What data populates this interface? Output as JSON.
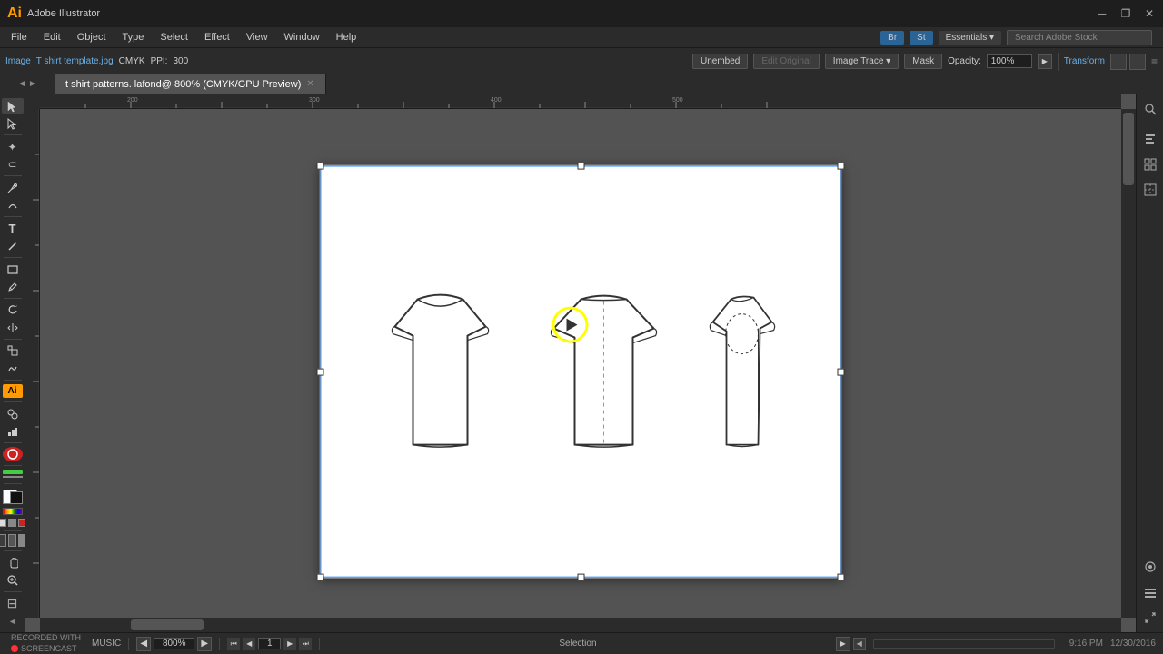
{
  "app": {
    "name": "Ai",
    "title": "Adobe Illustrator"
  },
  "titlebar": {
    "document_name": "t shirt patterns. lafond",
    "zoom": "800%",
    "color_mode": "CMYK/GPU Preview",
    "minimize": "─",
    "restore": "❐",
    "close": "✕"
  },
  "menubar": {
    "items": [
      "File",
      "Edit",
      "Object",
      "Type",
      "Select",
      "Effect",
      "View",
      "Window",
      "Help"
    ]
  },
  "propbar": {
    "image_label": "Image",
    "filename": "T shirt template.jpg",
    "color_mode": "CMYK",
    "ppi_label": "PPI:",
    "ppi_value": "300",
    "unembed_label": "Unembed",
    "edit_original_label": "Edit Original",
    "image_trace_label": "Image Trace",
    "mask_label": "Mask",
    "opacity_label": "Opacity:",
    "opacity_value": "100%",
    "transform_label": "Transform"
  },
  "tab": {
    "name": "t shirt patterns. lafond",
    "zoom": "800%",
    "color_mode": "CMYK/GPU Preview",
    "modified": true
  },
  "statusbar": {
    "zoom_value": "800%",
    "artboard_label": "1",
    "tool_name": "Selection",
    "time": "9:16 PM",
    "date": "12/30/2016",
    "recorded_with": "RECORDED WITH",
    "screencast": "SCREENCAST",
    "music_label": "MUSIC"
  },
  "tools": {
    "items": [
      "▶",
      "↖",
      "⊕",
      "✏",
      "P",
      "T",
      "╱",
      "☐",
      "〜",
      "☁",
      "◎",
      "▦",
      "Ai",
      "⊞",
      "≡",
      "⬜",
      "✂",
      "⊙",
      "⊙",
      "↔",
      "?",
      "▶"
    ]
  },
  "canvas": {
    "artboard_bg": "#ffffff",
    "selection_color": "#4a9eff"
  }
}
